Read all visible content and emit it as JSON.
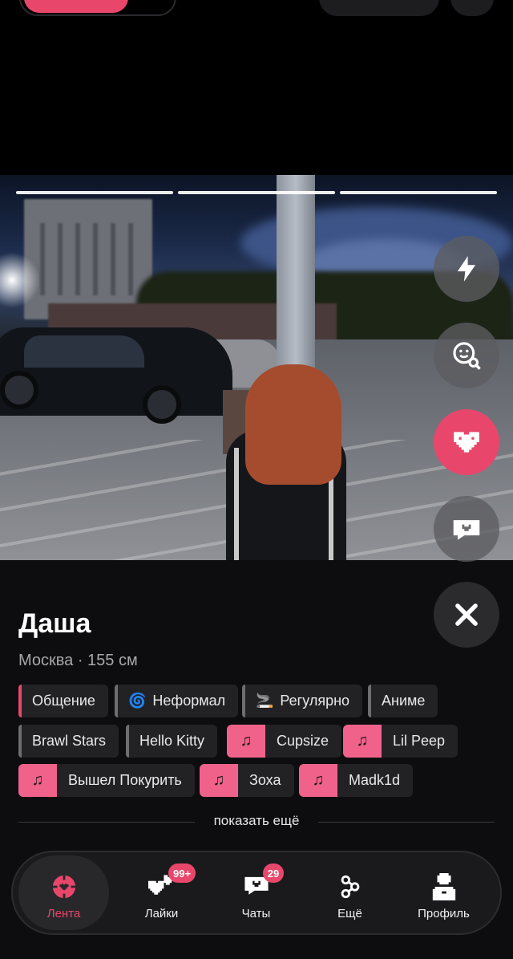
{
  "profile": {
    "name": "Даша",
    "meta": "Москва · 155 см"
  },
  "photo": {
    "total_photos": 3,
    "current_photo": 3
  },
  "actions": {
    "boost_icon": "lightning-icon",
    "search_icon": "face-search-icon",
    "like_icon": "pixel-heart-icon",
    "message_icon": "pixel-chat-heart-icon",
    "close_icon": "close-icon"
  },
  "tags": [
    {
      "label": "Общение",
      "style": "accent"
    },
    {
      "label": "Неформал",
      "emoji": "🌀",
      "style": "plain"
    },
    {
      "label": "Регулярно",
      "emoji": "🚬",
      "style": "plain"
    },
    {
      "label": "Аниме",
      "style": "plain"
    },
    {
      "label": "Brawl Stars",
      "style": "plain"
    },
    {
      "label": "Hello Kitty",
      "style": "plain"
    },
    {
      "label": "Cupsize",
      "style": "music"
    },
    {
      "label": "Lil Peep",
      "style": "music"
    },
    {
      "label": "Вышел Покурить",
      "style": "music"
    },
    {
      "label": "Зоха",
      "style": "music"
    },
    {
      "label": "Madk1d",
      "style": "music"
    }
  ],
  "show_more": "показать ещё",
  "tabs": [
    {
      "label": "Лента",
      "icon": "crosshair-heart-icon",
      "active": true
    },
    {
      "label": "Лайки",
      "icon": "pixel-hearts-icon",
      "badge": "99+"
    },
    {
      "label": "Чаты",
      "icon": "pixel-chat-icon",
      "badge": "29"
    },
    {
      "label": "Ещё",
      "icon": "nodes-icon"
    },
    {
      "label": "Профиль",
      "icon": "pixel-person-icon"
    }
  ],
  "colors": {
    "accent": "#e8476b",
    "music_tag": "#f0628a",
    "background": "#0d0d0f"
  }
}
